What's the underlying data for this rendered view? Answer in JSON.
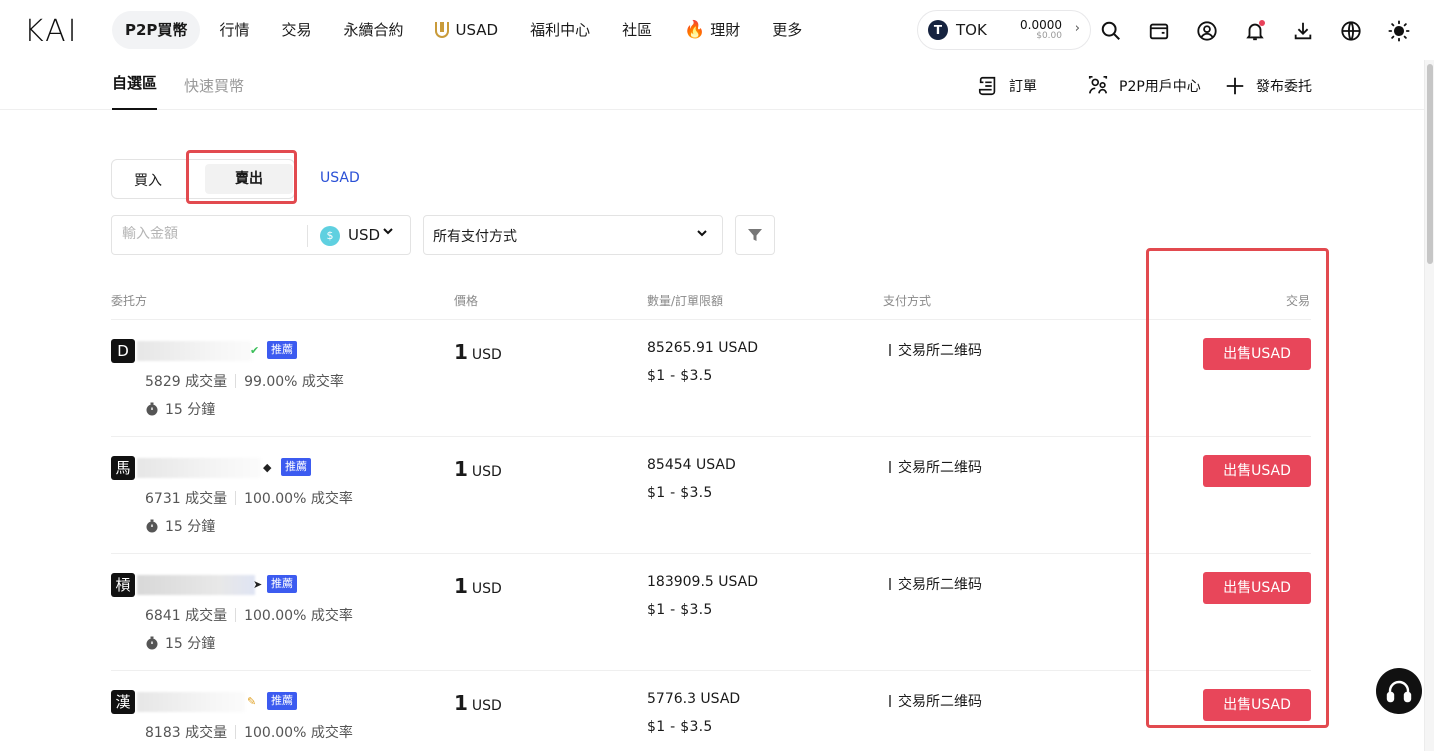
{
  "brand": "KAI",
  "nav": {
    "items": [
      {
        "label": "P2P買幣",
        "icon": "",
        "active": true
      },
      {
        "label": "行情",
        "icon": ""
      },
      {
        "label": "交易",
        "icon": ""
      },
      {
        "label": "永續合約",
        "icon": ""
      },
      {
        "label": "USAD",
        "icon": "usad-logo-icon"
      },
      {
        "label": "福利中心",
        "icon": ""
      },
      {
        "label": "社區",
        "icon": ""
      },
      {
        "label": "理財",
        "icon": "fire-icon"
      },
      {
        "label": "更多",
        "icon": ""
      }
    ],
    "token": {
      "symbol": "TOK",
      "logo": "T",
      "value": "0.0000",
      "fiat": "$0.00"
    }
  },
  "subnav": {
    "tabs": [
      {
        "label": "自選區",
        "active": true
      },
      {
        "label": "快速買幣"
      }
    ],
    "orders": "訂單",
    "user_center": "P2P用戶中心",
    "post_ad": "發布委托"
  },
  "trade": {
    "buy": "買入",
    "sell": "賣出",
    "coin": "USAD",
    "amount_placeholder": "輸入金額",
    "currency": "USD",
    "payment_filter": "所有支付方式"
  },
  "table": {
    "headers": {
      "advertiser": "委托方",
      "price": "價格",
      "qty_limit": "數量/訂單限額",
      "payment": "支付方式",
      "action": "交易"
    },
    "rows": [
      {
        "avatar": "D",
        "badge": "推薦",
        "verify_icon": "green-check-icon",
        "trades": "5829 成交量",
        "rate": "99.00% 成交率",
        "time": "15 分鐘",
        "price": "1",
        "price_currency": "USD",
        "qty": "85265.91 USAD",
        "limit": "$1  -  $3.5",
        "payment": "交易所二维码",
        "action": "出售USAD"
      },
      {
        "avatar": "馬",
        "badge": "推薦",
        "verify_icon": "diamond-icon",
        "trades": "6731 成交量",
        "rate": "100.00% 成交率",
        "time": "15 分鐘",
        "price": "1",
        "price_currency": "USD",
        "qty": "85454 USAD",
        "limit": "$1  -  $3.5",
        "payment": "交易所二维码",
        "action": "出售USAD"
      },
      {
        "avatar": "槓",
        "badge": "推薦",
        "verify_icon": "arrow-icon",
        "trades": "6841 成交量",
        "rate": "100.00% 成交率",
        "time": "15 分鐘",
        "price": "1",
        "price_currency": "USD",
        "qty": "183909.5 USAD",
        "limit": "$1  -  $3.5",
        "payment": "交易所二维码",
        "action": "出售USAD"
      },
      {
        "avatar": "漢",
        "badge": "推薦",
        "verify_icon": "gold-badge-icon",
        "trades": "8183 成交量",
        "rate": "100.00% 成交率",
        "time": "",
        "price": "1",
        "price_currency": "USD",
        "qty": "5776.3 USAD",
        "limit": "$1  -  $3.5",
        "payment": "交易所二维码",
        "action": "出售USAD"
      }
    ]
  },
  "colors": {
    "accent_red": "#e8465a",
    "recommend_blue": "#3c5bf0",
    "link_blue": "#2a50d6",
    "highlight_border": "#e24a4f"
  }
}
